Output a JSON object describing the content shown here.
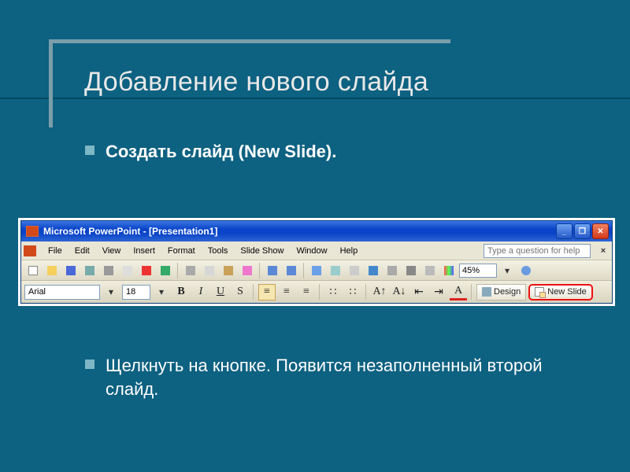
{
  "slide": {
    "title": "Добавление нового слайда",
    "bullet1": "Создать слайд (New Slide).",
    "bullet2": "Щелкнуть на кнопке. Появится незаполненный второй слайд."
  },
  "pp": {
    "title": "Microsoft PowerPoint - [Presentation1]",
    "menus": [
      "File",
      "Edit",
      "View",
      "Insert",
      "Format",
      "Tools",
      "Slide Show",
      "Window",
      "Help"
    ],
    "help_placeholder": "Type a question for help",
    "zoom": "45%",
    "font": "Arial",
    "font_size": "18",
    "design_label": "Design",
    "new_slide_label": "New Slide"
  }
}
